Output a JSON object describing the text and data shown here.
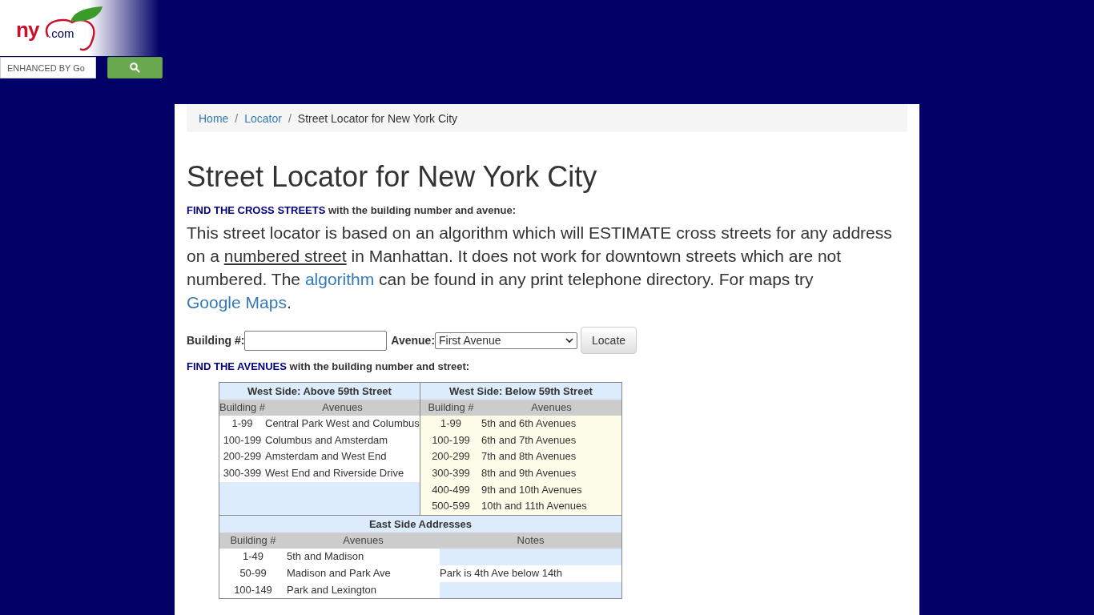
{
  "logo": {
    "brand": "ny",
    "suffix": ".com"
  },
  "search": {
    "placeholder": "ENHANCED BY Go"
  },
  "breadcrumb_separator": "/",
  "breadcrumb": [
    {
      "label": "Home",
      "kind": "link"
    },
    {
      "label": "Locator",
      "kind": "link"
    },
    {
      "label": "Street Locator for New York City",
      "kind": "current"
    }
  ],
  "title": "Street Locator for New York City",
  "cross_heading": {
    "lead": "FIND THE CROSS STREETS",
    "rest": " with the building number and avenue:"
  },
  "intro": [
    {
      "text": "This street locator is based on an algorithm which will ESTIMATE cross streets for any address on a ",
      "kind": "text"
    },
    {
      "text": "numbered street",
      "kind": "underline"
    },
    {
      "text": " in Manhattan. It does not work for downtown streets which are not numbered. The ",
      "kind": "text"
    },
    {
      "text": "algorithm",
      "kind": "link"
    },
    {
      "text": " can be found in any print telephone directory. For maps try ",
      "kind": "text"
    },
    {
      "text": "Google Maps",
      "kind": "link"
    },
    {
      "text": ".",
      "kind": "text"
    }
  ],
  "form": {
    "building_label": "Building #:",
    "avenue_label": "Avenue:",
    "avenue_value": "First Avenue",
    "button": "Locate"
  },
  "avenues_heading": {
    "lead": "FIND THE AVENUES",
    "rest": " with the building number and street:"
  },
  "west_above": {
    "title": "West Side: Above 59th Street",
    "columns": [
      "Building #",
      "Avenues"
    ],
    "rows": [
      [
        "1-99",
        "Central Park West and Columbus"
      ],
      [
        "100-199",
        "Columbus and Amsterdam"
      ],
      [
        "200-299",
        "Amsterdam and West End"
      ],
      [
        "300-399",
        "West End and Riverside Drive"
      ]
    ]
  },
  "west_below": {
    "title": "West Side: Below 59th Street",
    "columns": [
      "Building #",
      "Avenues"
    ],
    "rows": [
      [
        "1-99",
        "5th and 6th Avenues"
      ],
      [
        "100-199",
        "6th and 7th Avenues"
      ],
      [
        "200-299",
        "7th and 8th Avenues"
      ],
      [
        "300-399",
        "8th and 9th Avenues"
      ],
      [
        "400-499",
        "9th and 10th Avenues"
      ],
      [
        "500-599",
        "10th and 11th Avenues"
      ]
    ]
  },
  "east": {
    "title": "East Side Addresses",
    "columns": [
      "Building #",
      "Avenues",
      "Notes"
    ],
    "rows": [
      {
        "building": "1-49",
        "avenues": "5th and Madison"
      },
      {
        "building": "50-99",
        "avenues": "Madison and Park Ave",
        "notes": "Park is 4th Ave below 14th"
      },
      {
        "building": "100-149",
        "avenues": "Park and Lexington"
      }
    ]
  }
}
